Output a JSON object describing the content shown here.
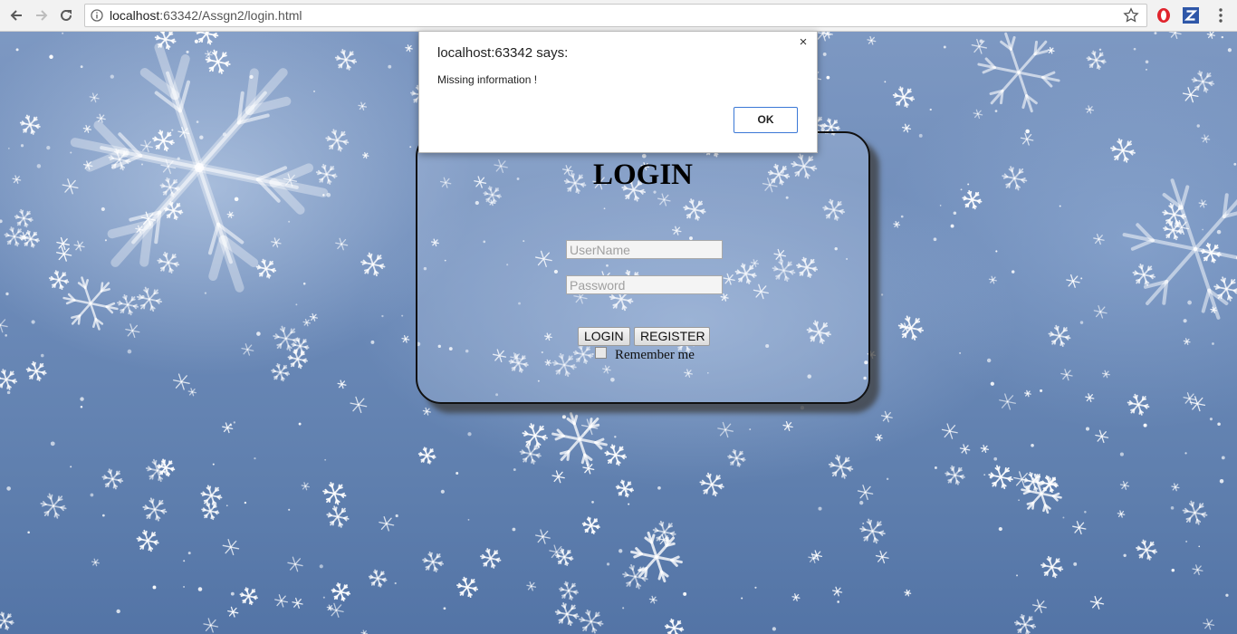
{
  "browser": {
    "url_host": "localhost",
    "url_path": ":63342/Assgn2/login.html",
    "colors": {
      "opera_red": "#e0242d",
      "z_blue": "#2f57a8"
    }
  },
  "login": {
    "title": "LOGIN",
    "username_placeholder": "UserName",
    "password_placeholder": "Password",
    "login_button": "LOGIN",
    "register_button": "REGISTER",
    "remember_label": "Remember me",
    "remember_checked": false
  },
  "dialog": {
    "title": "localhost:63342 says:",
    "message": "Missing information !",
    "ok_label": "OK",
    "close_glyph": "×"
  }
}
